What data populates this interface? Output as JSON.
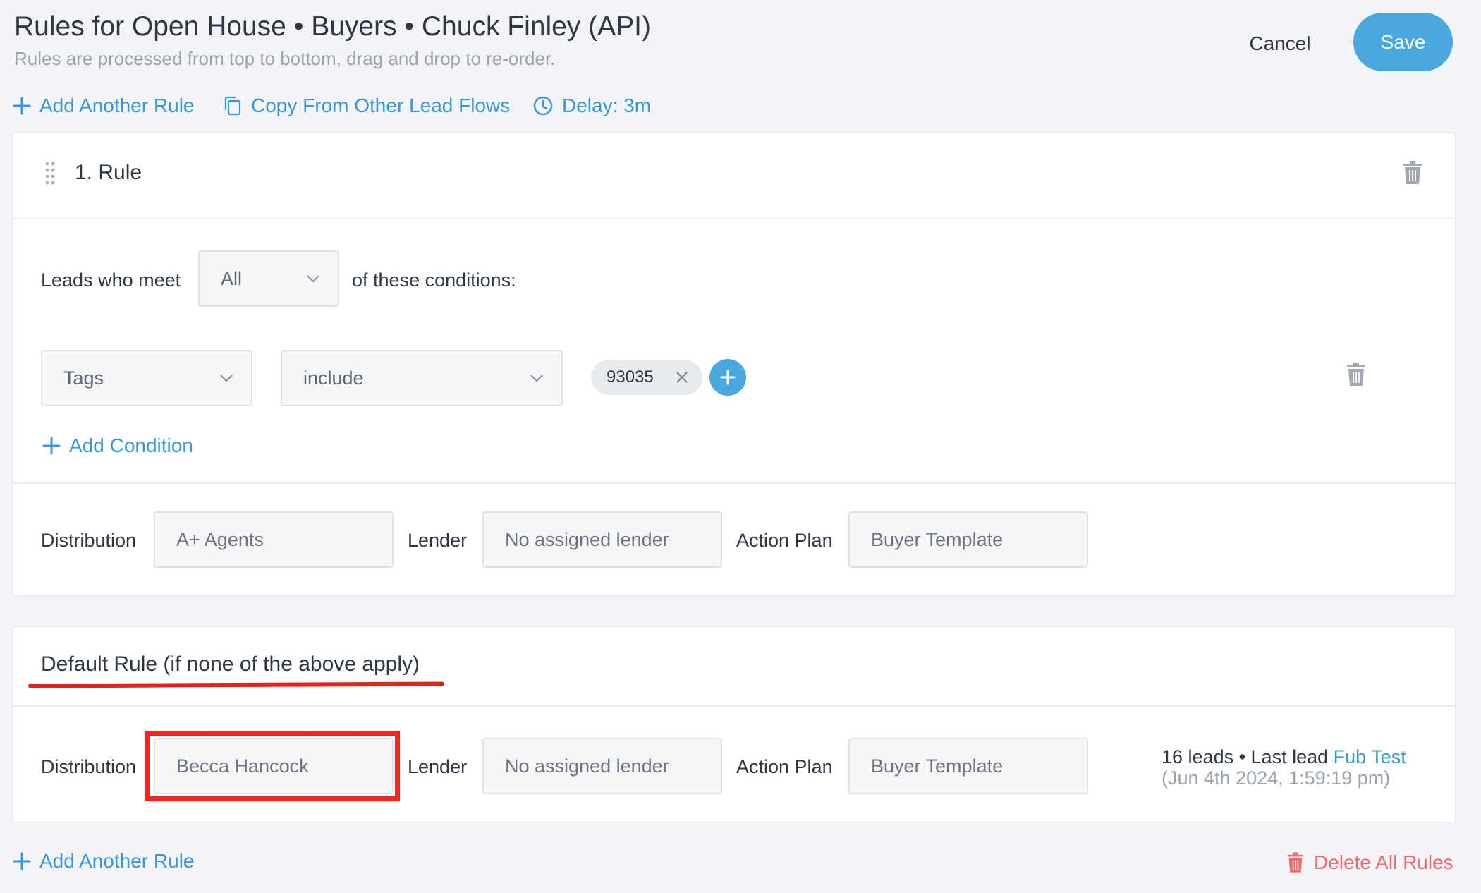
{
  "header": {
    "title": "Rules for Open House • Buyers • Chuck Finley (API)",
    "subtitle": "Rules are processed from top to bottom, drag and drop to re-order.",
    "cancel_label": "Cancel",
    "save_label": "Save"
  },
  "toolbar": {
    "add_rule_label": "Add Another Rule",
    "copy_label": "Copy From Other Lead Flows",
    "delay_label": "Delay: 3m"
  },
  "rule1": {
    "title": "1. Rule",
    "leads_meet_label": "Leads who meet",
    "match_value": "All",
    "conditions_label": "of these conditions:",
    "condition": {
      "field": "Tags",
      "operator": "include",
      "tag": "93035"
    },
    "add_condition_label": "Add Condition",
    "distribution_label": "Distribution",
    "distribution_value": "A+ Agents",
    "lender_label": "Lender",
    "lender_value": "No assigned lender",
    "action_plan_label": "Action Plan",
    "action_plan_value": "Buyer Template"
  },
  "default_rule": {
    "title": "Default Rule (if none of the above apply)",
    "distribution_label": "Distribution",
    "distribution_value": "Becca Hancock",
    "lender_label": "Lender",
    "lender_value": "No assigned lender",
    "action_plan_label": "Action Plan",
    "action_plan_value": "Buyer Template",
    "leads_count": "16 leads • Last lead",
    "last_lead_name": "Fub Test",
    "last_lead_date": "(Jun 4th 2024, 1:59:19 pm)"
  },
  "footer": {
    "add_rule_label": "Add Another Rule",
    "delete_all_label": "Delete All Rules"
  },
  "colors": {
    "accent": "#4aa8de",
    "link": "#3a97d4",
    "danger": "#ef6b6b",
    "highlight_red": "#f2261c"
  }
}
